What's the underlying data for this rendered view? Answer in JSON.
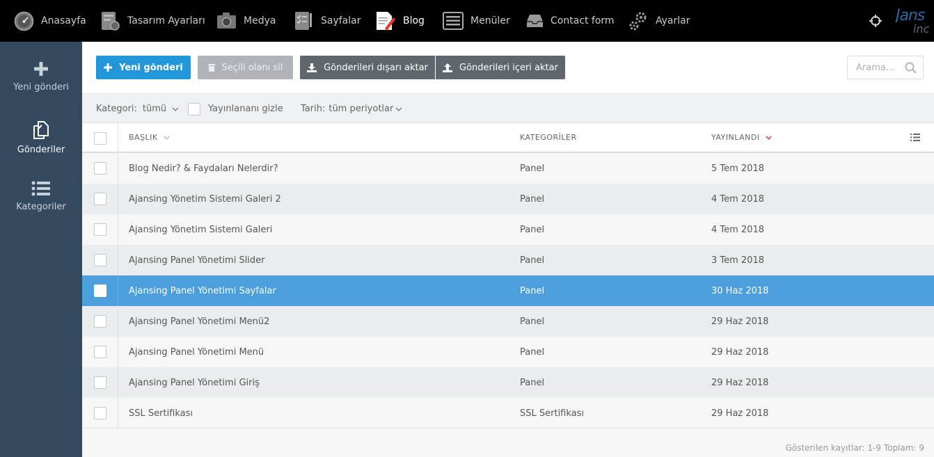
{
  "topnav": {
    "items": [
      {
        "label": "Anasayfa",
        "icon": "speedometer-icon"
      },
      {
        "label": "Tasarım Ayarları",
        "icon": "design-settings-icon"
      },
      {
        "label": "Medya",
        "icon": "camera-icon"
      },
      {
        "label": "Sayfalar",
        "icon": "pages-icon"
      },
      {
        "label": "Blog",
        "icon": "blog-icon",
        "active": true
      },
      {
        "label": "Menüler",
        "icon": "menu-list-icon"
      },
      {
        "label": "Contact form",
        "icon": "inbox-icon"
      },
      {
        "label": "Ayarlar",
        "icon": "gears-icon"
      }
    ],
    "brand": {
      "line1": "Jans",
      "line2": "inc"
    }
  },
  "sidebar": {
    "items": [
      {
        "label": "Yeni gönderi",
        "icon": "plus-icon"
      },
      {
        "label": "Gönderiler",
        "icon": "documents-icon",
        "active": true
      },
      {
        "label": "Kategoriler",
        "icon": "list-icon"
      }
    ]
  },
  "toolbar": {
    "new_post": "Yeni gönderi",
    "delete_selected": "Seçili olanı sil",
    "export": "Gönderileri dışarı aktar",
    "import": "Gönderileri içeri aktar",
    "search_placeholder": "Arama..."
  },
  "filters": {
    "category_label": "Kategori:",
    "category_value": "tümü",
    "hide_published": "Yayınlananı gizle",
    "date_label": "Tarih:",
    "date_value": "tüm periyotlar"
  },
  "table": {
    "columns": {
      "title": "BAŞLIK",
      "categories": "KATEGORİLER",
      "published": "YAYINLANDI"
    },
    "rows": [
      {
        "title": "Blog Nedir? & Faydaları Nelerdir?",
        "category": "Panel",
        "date": "5 Tem 2018"
      },
      {
        "title": "Ajansing Yönetim Sistemi Galeri 2",
        "category": "Panel",
        "date": "4 Tem 2018"
      },
      {
        "title": "Ajansing Yönetim Sistemi Galeri",
        "category": "Panel",
        "date": "4 Tem 2018"
      },
      {
        "title": "Ajansing Panel Yönetimi Slider",
        "category": "Panel",
        "date": "3 Tem 2018"
      },
      {
        "title": "Ajansing Panel Yönetimi Sayfalar",
        "category": "Panel",
        "date": "30 Haz 2018",
        "selected": true
      },
      {
        "title": "Ajansing Panel Yönetimi Menü2",
        "category": "Panel",
        "date": "29 Haz 2018"
      },
      {
        "title": "Ajansing Panel Yönetimi Menü",
        "category": "Panel",
        "date": "29 Haz 2018"
      },
      {
        "title": "Ajansing Panel Yönetimi Giriş",
        "category": "Panel",
        "date": "29 Haz 2018"
      },
      {
        "title": "SSL Sertifikası",
        "category": "SSL Sertifikası",
        "date": "29 Haz 2018"
      }
    ]
  },
  "footer": {
    "records": "Gösterilen kayıtlar: 1-9 Toplam: 9"
  },
  "colors": {
    "primary": "#2196d9",
    "sidebar": "#34495e",
    "selected_row": "#4a9fdc",
    "sort_arrow": "#e0393e"
  }
}
